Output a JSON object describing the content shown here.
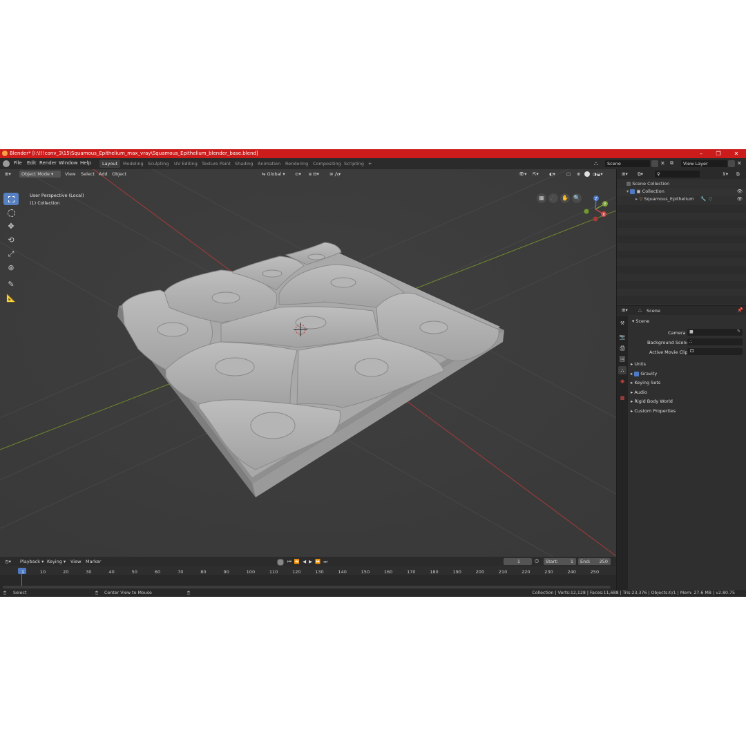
{
  "window": {
    "title": "Blender* [I:\\!!!conv_3\\15\\Squamous_Epithelium_max_vray\\Squamous_Epithelium_blender_base.blend]"
  },
  "menu": {
    "items": [
      "File",
      "Edit",
      "Render",
      "Window",
      "Help"
    ]
  },
  "workspaces": [
    "Layout",
    "Modeling",
    "Sculpting",
    "UV Editing",
    "Texture Paint",
    "Shading",
    "Animation",
    "Rendering",
    "Compositing",
    "Scripting"
  ],
  "active_workspace": "Layout",
  "scene_field": "Scene",
  "view_layer_field": "View Layer",
  "viewport": {
    "mode": "Object Mode",
    "header_menus": [
      "View",
      "Select",
      "Add",
      "Object"
    ],
    "orientation": "Global",
    "perspective_label": "User Perspective (Local)",
    "collection_label": "(1) Collection",
    "gizmo_axes": {
      "x": "X",
      "y": "Y",
      "z": "Z"
    }
  },
  "outliner": {
    "scene_collection": "Scene Collection",
    "collection": "Collection",
    "object": "Squamous_Epithelium"
  },
  "properties": {
    "header": "Scene",
    "panel": "Scene",
    "fields": [
      "Camera",
      "Background Scene",
      "Active Movie Clip"
    ],
    "subpanels": [
      "Units",
      "Gravity",
      "Keying Sets",
      "Audio",
      "Rigid Body World",
      "Custom Properties"
    ],
    "gravity_checked": true
  },
  "timeline": {
    "menus": [
      "Playback",
      "Keying",
      "View",
      "Marker"
    ],
    "current_frame": "1",
    "start_label": "Start:",
    "start": "1",
    "end_label": "End:",
    "end": "250",
    "ticks": [
      "1",
      "10",
      "20",
      "30",
      "40",
      "50",
      "60",
      "70",
      "80",
      "90",
      "100",
      "110",
      "120",
      "130",
      "140",
      "150",
      "160",
      "170",
      "180",
      "190",
      "200",
      "210",
      "220",
      "230",
      "240",
      "250"
    ]
  },
  "statusbar": {
    "select": "Select",
    "center": "Center View to Mouse",
    "stats": "Collection | Verts:12,128 | Faces:11,688 | Tris:23,376 | Objects:0/1 | Mem: 27.6 MB | v2.80.75"
  },
  "colors": {
    "titlebar": "#cc1b1b",
    "accent": "#4f7ac4",
    "viewport_bg": "#3c3c3c",
    "x_axis": "#b03a3a",
    "y_axis": "#7b9a2c"
  }
}
